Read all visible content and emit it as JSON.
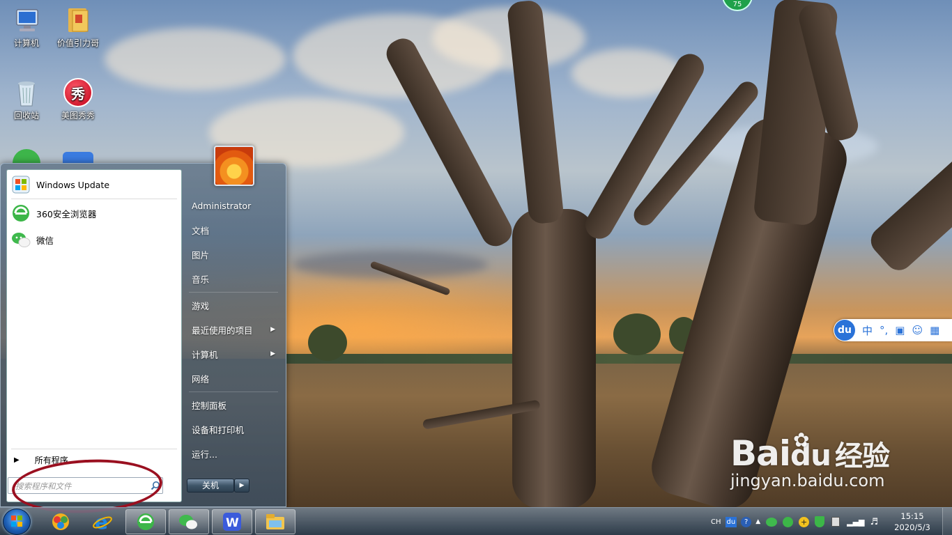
{
  "desktop": {
    "icons": [
      {
        "label": "计算机",
        "icon": "computer-icon"
      },
      {
        "label": "价值引力哥",
        "icon": "folder-icon"
      },
      {
        "label": "回收站",
        "icon": "recycle-bin-icon"
      },
      {
        "label": "美图秀秀",
        "icon": "meitu-icon",
        "glyph": "秀"
      }
    ],
    "badge": "75"
  },
  "start_menu": {
    "pinned": [
      {
        "label": "Windows Update",
        "icon": "windows-update-icon"
      },
      {
        "label": "360安全浏览器",
        "icon": "360-browser-icon"
      },
      {
        "label": "微信",
        "icon": "wechat-icon"
      }
    ],
    "all_programs": "所有程序",
    "search_placeholder": "搜索程序和文件",
    "right": [
      {
        "label": "Administrator"
      },
      {
        "label": "文档"
      },
      {
        "label": "图片"
      },
      {
        "label": "音乐"
      },
      {
        "label": "游戏"
      },
      {
        "label": "最近使用的项目",
        "submenu": true
      },
      {
        "label": "计算机",
        "submenu": true
      },
      {
        "label": "网络"
      },
      {
        "label": "控制面板"
      },
      {
        "label": "设备和打印机"
      },
      {
        "label": "运行..."
      }
    ],
    "shutdown": "关机"
  },
  "ime": {
    "logo": "du",
    "mode": "中",
    "punct": "°,"
  },
  "taskbar": {
    "apps": [
      "ie-icon",
      "360-browser-icon",
      "wechat-icon",
      "wps-icon",
      "explorer-icon"
    ],
    "tray": {
      "lang": "CH",
      "ime": "du",
      "help": "?"
    },
    "time": "15:15",
    "date": "2020/5/3"
  },
  "watermark": {
    "brand_left": "Bai",
    "brand_mid": "du",
    "brand_cn": "经验",
    "url": "jingyan.baidu.com"
  },
  "colors": {
    "annotation": "#9a1020",
    "accent": "#2a72d8"
  }
}
